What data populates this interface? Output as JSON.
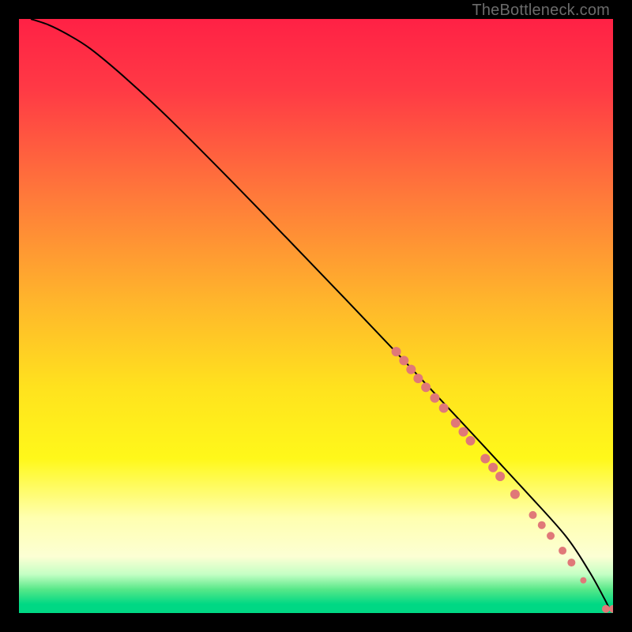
{
  "watermark": "TheBottleneck.com",
  "chart_data": {
    "type": "line",
    "title": "",
    "xlabel": "",
    "ylabel": "",
    "xlim": [
      0,
      100
    ],
    "ylim": [
      0,
      100
    ],
    "grid": false,
    "background": {
      "type": "vertical-gradient",
      "stops": [
        {
          "t": 0.0,
          "color": "#ff2145"
        },
        {
          "t": 0.12,
          "color": "#ff3a45"
        },
        {
          "t": 0.3,
          "color": "#ff7a3a"
        },
        {
          "t": 0.48,
          "color": "#ffb72b"
        },
        {
          "t": 0.62,
          "color": "#ffe21e"
        },
        {
          "t": 0.74,
          "color": "#fff81a"
        },
        {
          "t": 0.84,
          "color": "#ffffb0"
        },
        {
          "t": 0.905,
          "color": "#fcffd4"
        },
        {
          "t": 0.935,
          "color": "#c4ffc4"
        },
        {
          "t": 0.96,
          "color": "#58e889"
        },
        {
          "t": 0.985,
          "color": "#00d884"
        },
        {
          "t": 1.0,
          "color": "#00d884"
        }
      ]
    },
    "series": [
      {
        "name": "curve",
        "color": "#000000",
        "stroke_width": 2,
        "x": [
          2,
          5,
          8,
          12,
          18,
          25,
          35,
          45,
          55,
          65,
          75,
          85,
          92,
          96,
          98.5,
          99.5
        ],
        "y": [
          100,
          99,
          97.5,
          95,
          90,
          83.5,
          73.5,
          63.2,
          52.8,
          42.3,
          31.6,
          20.8,
          13.0,
          7.0,
          2.5,
          0.5
        ]
      }
    ],
    "markers": {
      "color": "#e07878",
      "points": [
        {
          "x": 63.5,
          "y": 44.0,
          "r": 6
        },
        {
          "x": 64.8,
          "y": 42.5,
          "r": 6
        },
        {
          "x": 66.0,
          "y": 41.0,
          "r": 6
        },
        {
          "x": 67.2,
          "y": 39.5,
          "r": 6
        },
        {
          "x": 68.5,
          "y": 38.0,
          "r": 6
        },
        {
          "x": 70.0,
          "y": 36.2,
          "r": 6
        },
        {
          "x": 71.5,
          "y": 34.5,
          "r": 6
        },
        {
          "x": 73.5,
          "y": 32.0,
          "r": 6
        },
        {
          "x": 74.8,
          "y": 30.5,
          "r": 6
        },
        {
          "x": 76.0,
          "y": 29.0,
          "r": 6
        },
        {
          "x": 78.5,
          "y": 26.0,
          "r": 6
        },
        {
          "x": 79.8,
          "y": 24.5,
          "r": 6
        },
        {
          "x": 81.0,
          "y": 23.0,
          "r": 6
        },
        {
          "x": 83.5,
          "y": 20.0,
          "r": 6
        },
        {
          "x": 86.5,
          "y": 16.5,
          "r": 5
        },
        {
          "x": 88.0,
          "y": 14.8,
          "r": 5
        },
        {
          "x": 89.5,
          "y": 13.0,
          "r": 5
        },
        {
          "x": 91.5,
          "y": 10.5,
          "r": 5
        },
        {
          "x": 93.0,
          "y": 8.5,
          "r": 5
        },
        {
          "x": 95.0,
          "y": 5.5,
          "r": 4
        },
        {
          "x": 98.8,
          "y": 0.7,
          "r": 5
        },
        {
          "x": 100.0,
          "y": 0.7,
          "r": 5
        }
      ]
    }
  }
}
